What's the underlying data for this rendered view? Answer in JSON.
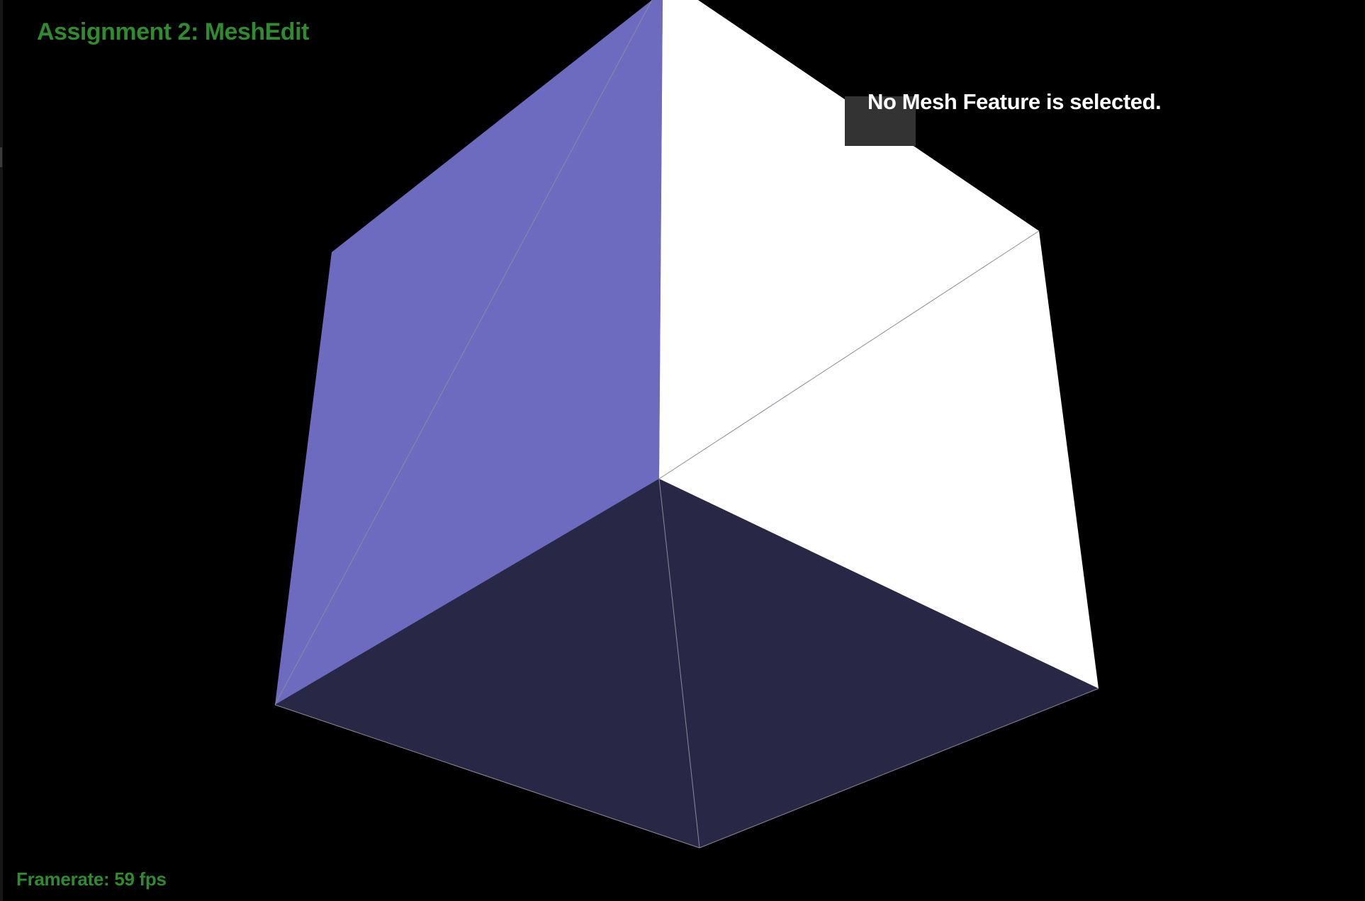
{
  "app": {
    "title": "Assignment 2: MeshEdit"
  },
  "status": {
    "framerate_label": "Framerate: 59 fps"
  },
  "selection_panel": {
    "message": "No Mesh Feature is selected."
  },
  "mesh": {
    "object": "cube",
    "colors": {
      "left_face": "#6C6BBF",
      "top_face": "#FFFFFF",
      "bottom_face": "#282846",
      "edge": "#8a8a9a"
    }
  },
  "colors": {
    "background": "#000000",
    "title": "#2E8B2E",
    "framerate": "#2E8B2E",
    "panel_bg": "#333333",
    "panel_text": "#FFFFFF"
  }
}
